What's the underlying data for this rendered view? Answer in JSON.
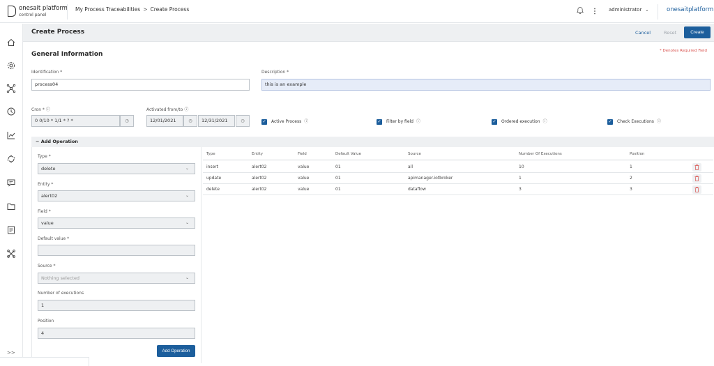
{
  "topbar": {
    "logo_name": "onesait platform",
    "logo_sub": "control panel",
    "breadcrumb": [
      "My Process Traceabilities",
      "Create Process"
    ],
    "breadcrumb_sep": ">",
    "user": "administrator",
    "brand": "onesaitplatform"
  },
  "header": {
    "title": "Create Process",
    "cancel": "Cancel",
    "reset": "Reset",
    "create": "Create"
  },
  "general": {
    "title": "General Information",
    "required_note": "* Denotes Required Field",
    "identification_label": "Identification *",
    "identification_value": "process04",
    "description_label": "Description *",
    "description_value": "this is an example",
    "cron_label": "Cron *",
    "cron_value": "0 0/10 * 1/1 * ? *",
    "activated_label": "Activated from/to",
    "date_from": "12/01/2021",
    "date_to": "12/31/2021",
    "checkboxes": [
      {
        "label": "Active Process",
        "checked": true
      },
      {
        "label": "Filter by field",
        "checked": true
      },
      {
        "label": "Ordered execution",
        "checked": true
      },
      {
        "label": "Check Executions",
        "checked": true
      }
    ]
  },
  "add_operation": {
    "title": "Add Operation",
    "toggle": "−",
    "type_label": "Type *",
    "type_value": "delete",
    "entity_label": "Entity *",
    "entity_value": "alert02",
    "field_label": "Field *",
    "field_value": "value",
    "default_label": "Default value *",
    "default_value": "",
    "source_label": "Source *",
    "source_value": "Nothing selected",
    "executions_label": "Number of executions",
    "executions_value": "1",
    "position_label": "Position",
    "position_value": "4",
    "button": "Add Operation"
  },
  "table": {
    "headers": [
      "Type",
      "Entity",
      "Field",
      "Default Value",
      "Source",
      "Number Of Executions",
      "Position"
    ],
    "rows": [
      [
        "insert",
        "alert02",
        "value",
        "01",
        "all",
        "10",
        "1"
      ],
      [
        "update",
        "alert02",
        "value",
        "01",
        "apimanager.iotbroker",
        "1",
        "2"
      ],
      [
        "delete",
        "alert02",
        "value",
        "01",
        "dataflow",
        "3",
        "3"
      ]
    ]
  },
  "colors": {
    "primary": "#1c5e9c",
    "danger": "#d9534f"
  }
}
